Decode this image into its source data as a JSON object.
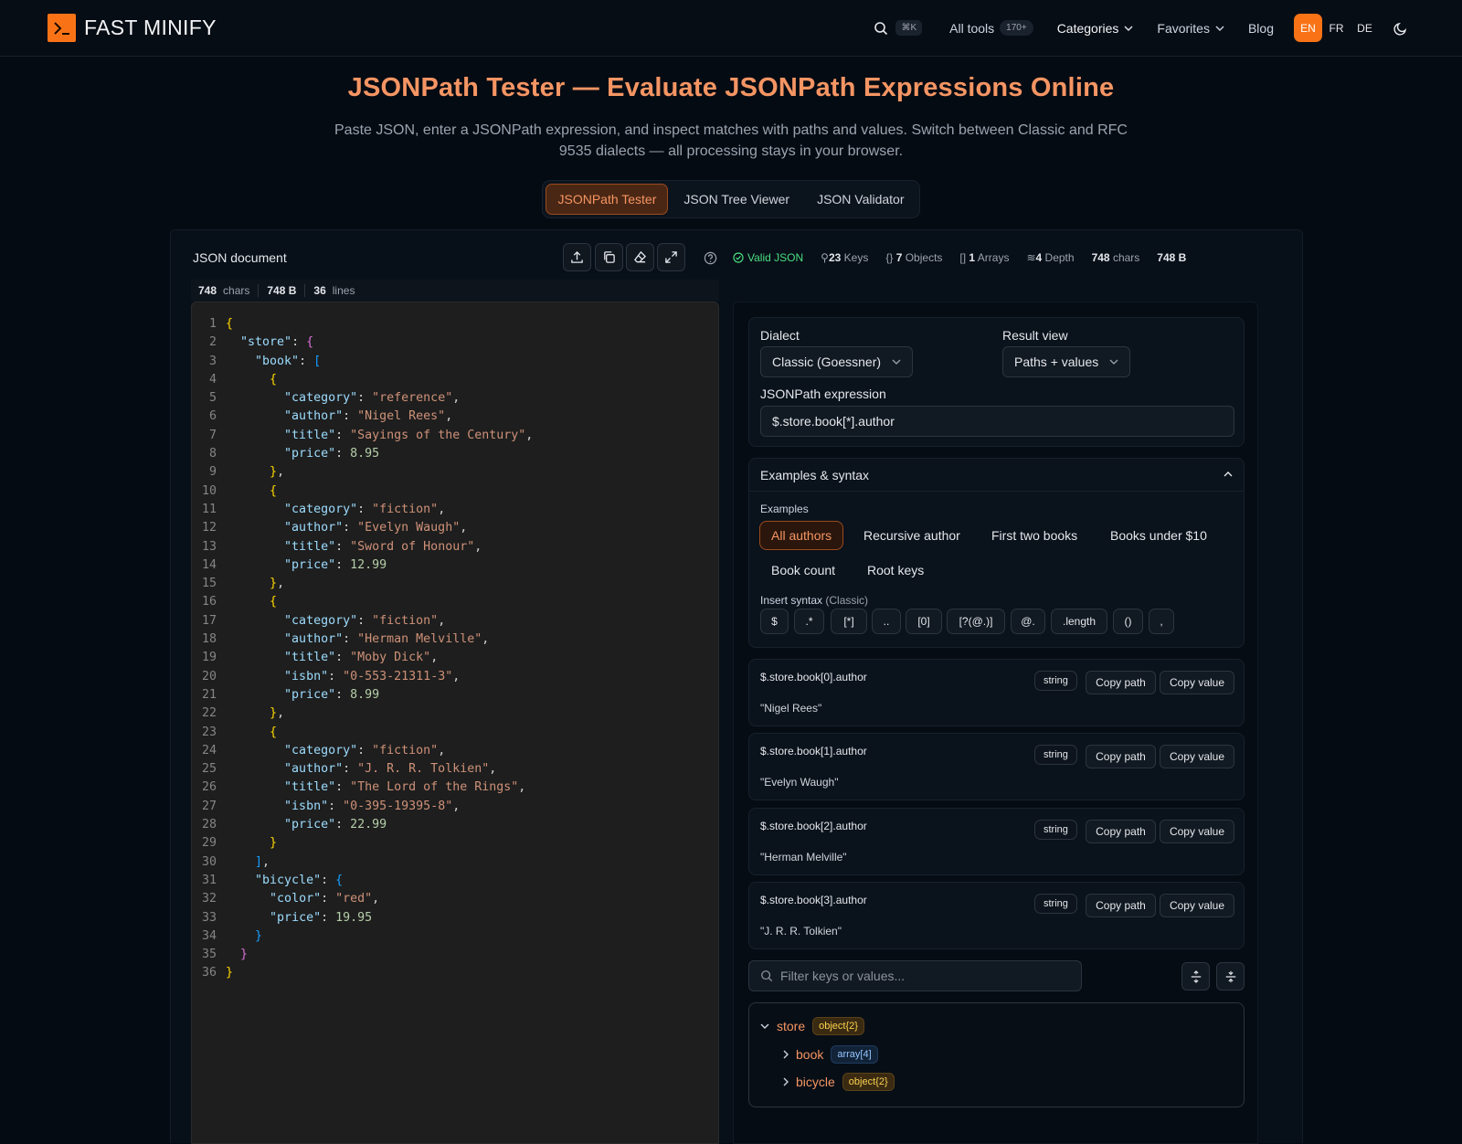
{
  "nav": {
    "brand": "FAST MINIFY",
    "search_shortcut": "⌘K",
    "all_tools": "All tools",
    "all_tools_count": "170+",
    "categories": "Categories",
    "favorites": "Favorites",
    "blog": "Blog",
    "languages": [
      "EN",
      "FR",
      "DE"
    ],
    "active_language": "EN",
    "accent": "#f97316"
  },
  "hero": {
    "title": "JSONPath Tester — Evaluate JSONPath Expressions Online",
    "subtitle": "Paste JSON, enter a JSONPath expression, and inspect matches with paths and values. Switch between Classic and RFC 9535 dialects — all processing stays in your browser.",
    "tabs": [
      "JSONPath Tester",
      "JSON Tree Viewer",
      "JSON Validator"
    ],
    "active_tab": "JSONPath Tester"
  },
  "document": {
    "title": "JSON document",
    "tools": [
      "upload-icon",
      "copy-icon",
      "eraser-icon",
      "expand-icon",
      "help-icon"
    ],
    "stats": {
      "valid": "Valid JSON",
      "keys": "23",
      "keys_label": "Keys",
      "objects": "7",
      "objects_label": "Objects",
      "arrays": "1",
      "arrays_label": "Arrays",
      "depth": "4",
      "depth_label": "Depth",
      "chars": "748",
      "chars_label": "chars",
      "bytes": "748 B"
    },
    "meta": {
      "chars": "748",
      "chars_label": "chars",
      "bytes": "748 B",
      "lines": "36",
      "lines_label": "lines"
    },
    "code": [
      "{",
      "  \"store\": {",
      "    \"book\": [",
      "      {",
      "        \"category\": \"reference\",",
      "        \"author\": \"Nigel Rees\",",
      "        \"title\": \"Sayings of the Century\",",
      "        \"price\": 8.95",
      "      },",
      "      {",
      "        \"category\": \"fiction\",",
      "        \"author\": \"Evelyn Waugh\",",
      "        \"title\": \"Sword of Honour\",",
      "        \"price\": 12.99",
      "      },",
      "      {",
      "        \"category\": \"fiction\",",
      "        \"author\": \"Herman Melville\",",
      "        \"title\": \"Moby Dick\",",
      "        \"isbn\": \"0-553-21311-3\",",
      "        \"price\": 8.99",
      "      },",
      "      {",
      "        \"category\": \"fiction\",",
      "        \"author\": \"J. R. R. Tolkien\",",
      "        \"title\": \"The Lord of the Rings\",",
      "        \"isbn\": \"0-395-19395-8\",",
      "        \"price\": 22.99",
      "      }",
      "    ],",
      "    \"bicycle\": {",
      "      \"color\": \"red\",",
      "      \"price\": 19.95",
      "    }",
      "  }",
      "}"
    ]
  },
  "query": {
    "dialect_label": "Dialect",
    "dialect_value": "Classic (Goessner)",
    "result_view_label": "Result view",
    "result_view_value": "Paths + values",
    "expression_label": "JSONPath expression",
    "expression_value": "$.store.book[*].author"
  },
  "examples": {
    "header": "Examples & syntax",
    "examples_label": "Examples",
    "chips": [
      "All authors",
      "Recursive author",
      "First two books",
      "Books under $10",
      "Book count",
      "Root keys"
    ],
    "active_chip": "All authors",
    "syntax_label": "Insert syntax",
    "syntax_dialect": "(Classic)",
    "syntax_tokens": [
      "$",
      ".*",
      "[*]",
      "..",
      "[0]",
      "[?(@.)]",
      "@.",
      ".length",
      "()",
      ","
    ]
  },
  "results": [
    {
      "path": "$.store.book[0].author",
      "type": "string",
      "value": "\"Nigel Rees\""
    },
    {
      "path": "$.store.book[1].author",
      "type": "string",
      "value": "\"Evelyn Waugh\""
    },
    {
      "path": "$.store.book[2].author",
      "type": "string",
      "value": "\"Herman Melville\""
    },
    {
      "path": "$.store.book[3].author",
      "type": "string",
      "value": "\"J. R. R. Tolkien\""
    }
  ],
  "result_buttons": {
    "copy_path": "Copy path",
    "copy_value": "Copy value"
  },
  "filter": {
    "placeholder": "Filter keys or values..."
  },
  "tree": [
    {
      "key": "store",
      "badge": "object{2}",
      "expanded": true
    },
    {
      "key": "book",
      "badge": "array[4]",
      "expanded": false
    },
    {
      "key": "bicycle",
      "badge": "object{2}",
      "expanded": false
    }
  ]
}
